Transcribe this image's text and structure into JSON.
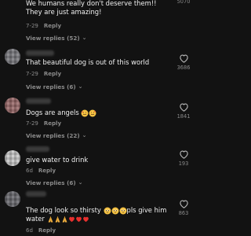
{
  "comments": [
    {
      "text": "We humans really don't deserve them!! They are just amazing!",
      "date": "7-29",
      "reply_label": "Reply",
      "view_replies": "View replies (52)",
      "likes": "5070",
      "avatar_color": "#8a6a4a"
    },
    {
      "text": "That beautiful dog is out of this world",
      "date": "7-29",
      "reply_label": "Reply",
      "view_replies": "View replies (6)",
      "likes": "3686",
      "avatar_color": "#7a7a80"
    },
    {
      "text": "Dogs are angels",
      "emoji": [
        "smiling-face-with-hearts-emoji",
        "smiling-face-with-hearts-emoji"
      ],
      "date": "7-29",
      "reply_label": "Reply",
      "view_replies": "View replies (22)",
      "likes": "1841",
      "avatar_color": "#9a6a6a"
    },
    {
      "text": "give water to drink",
      "date": "6d",
      "reply_label": "Reply",
      "view_replies": "View replies (6)",
      "likes": "193",
      "avatar_color": "#c8c8c8"
    },
    {
      "text_parts": [
        "The dog look so thirsty",
        "pls give him water"
      ],
      "emoji_after_part1": [
        "pleading-face-emoji",
        "pleading-face-emoji",
        "pleading-face-emoji"
      ],
      "emoji_after_part2": [
        "folded-hands-emoji",
        "folded-hands-emoji",
        "folded-hands-emoji",
        "red-heart-emoji",
        "red-heart-emoji",
        "red-heart-emoji"
      ],
      "date": "6d",
      "reply_label": "Reply",
      "likes": "863",
      "avatar_color": "#6a6a70"
    }
  ],
  "colors": {
    "background": "#121212",
    "text": "#f0f0f0",
    "muted": "#8a8a8a"
  }
}
